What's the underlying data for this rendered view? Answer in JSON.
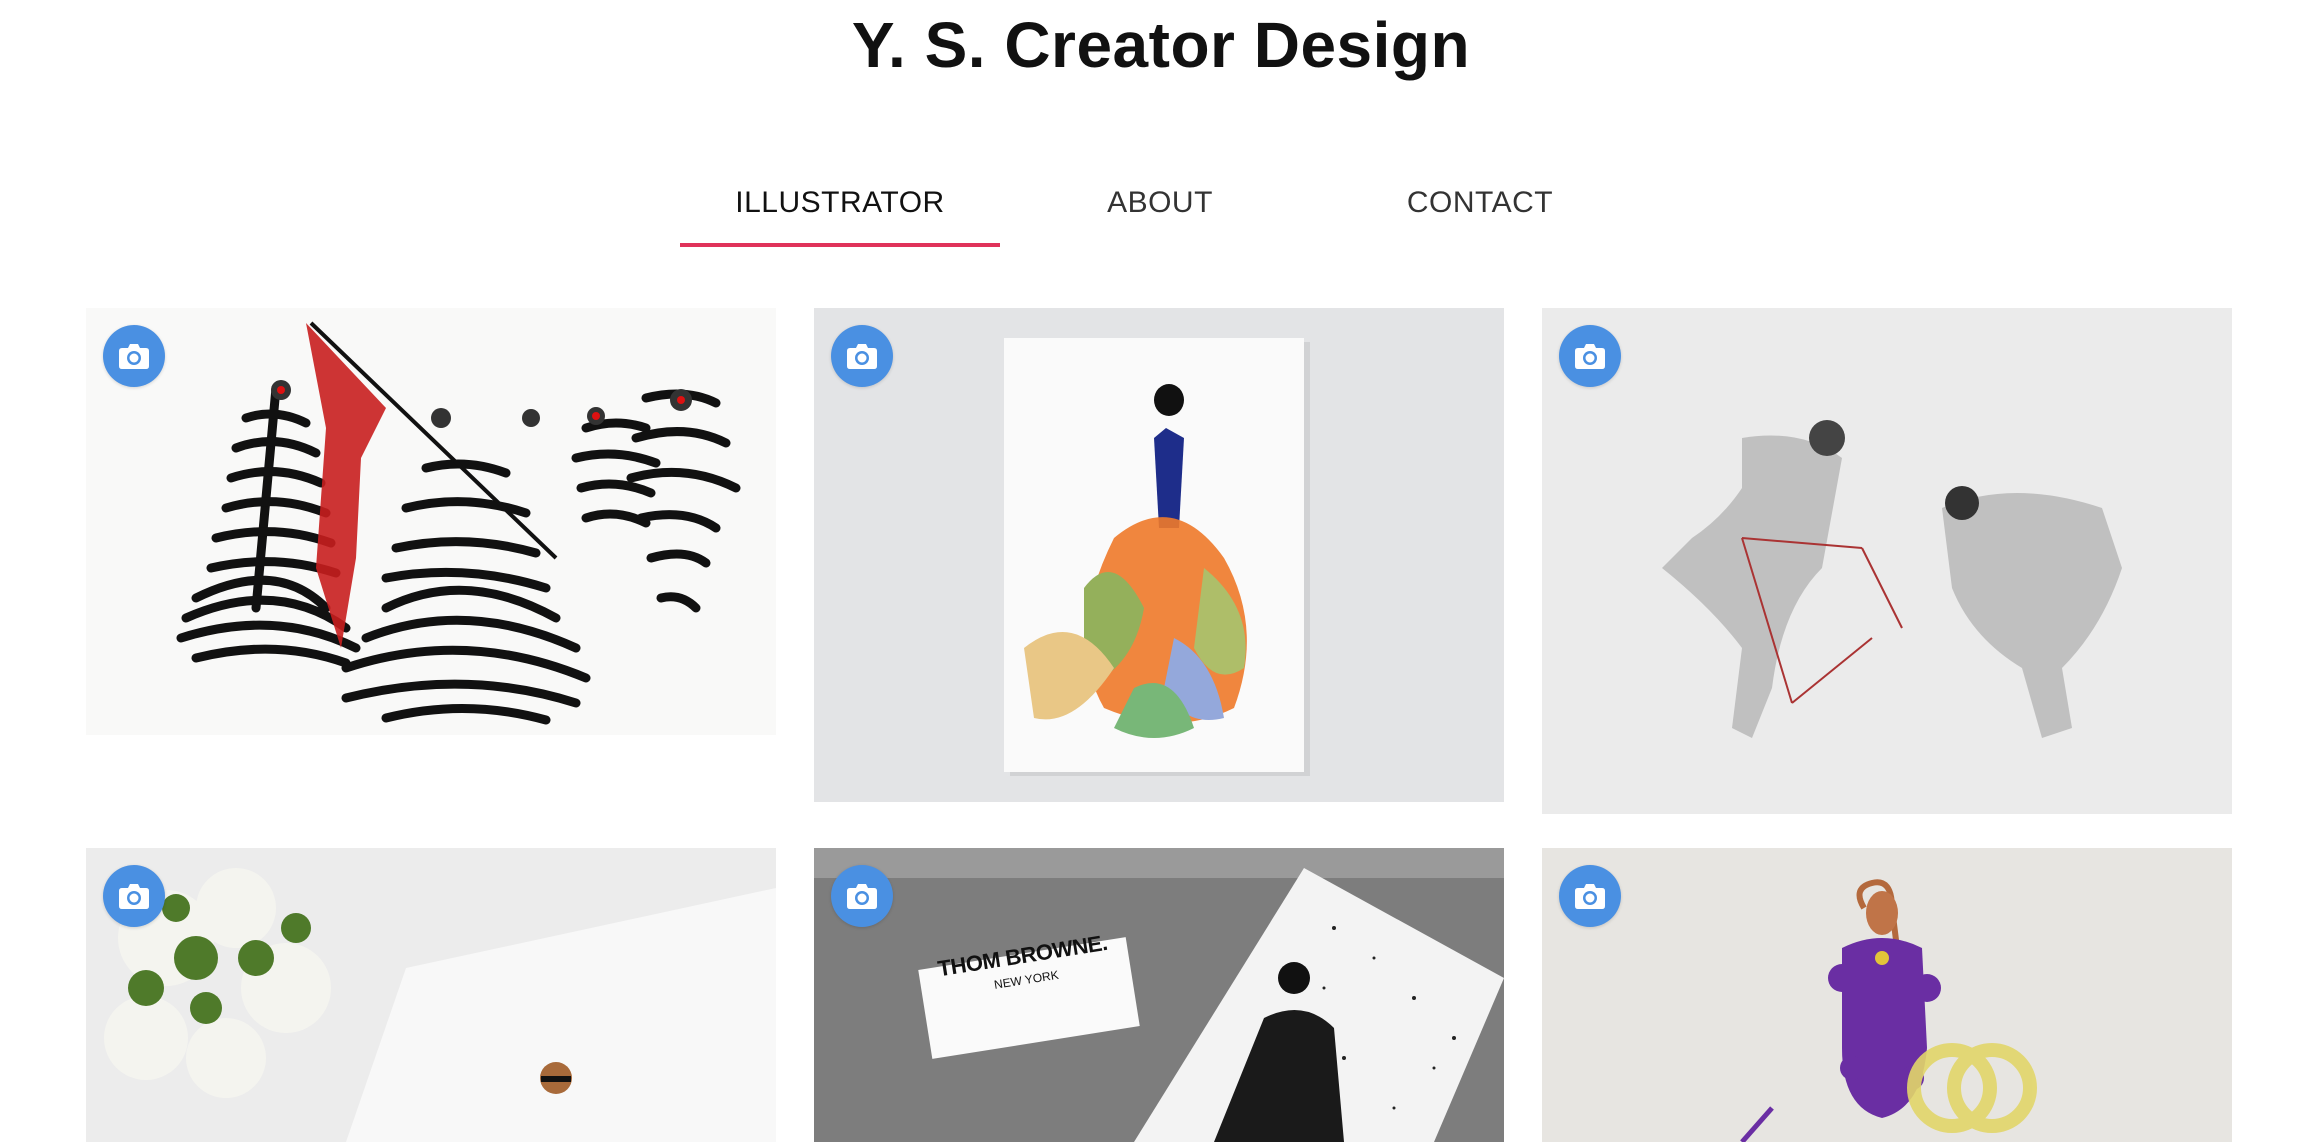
{
  "site": {
    "title": "Y. S. Creator Design"
  },
  "nav": {
    "tabs": [
      {
        "label": "ILLUSTRATOR",
        "active": true
      },
      {
        "label": "ABOUT",
        "active": false
      },
      {
        "label": "CONTACT",
        "active": false
      }
    ],
    "accent_color": "#e0325a"
  },
  "gallery": {
    "badge_icon": "camera-icon",
    "badge_color": "#4a90e2",
    "tiles": [
      {
        "label": "THOM BROWNE.",
        "sublabel": "NEW YORK"
      }
    ]
  }
}
